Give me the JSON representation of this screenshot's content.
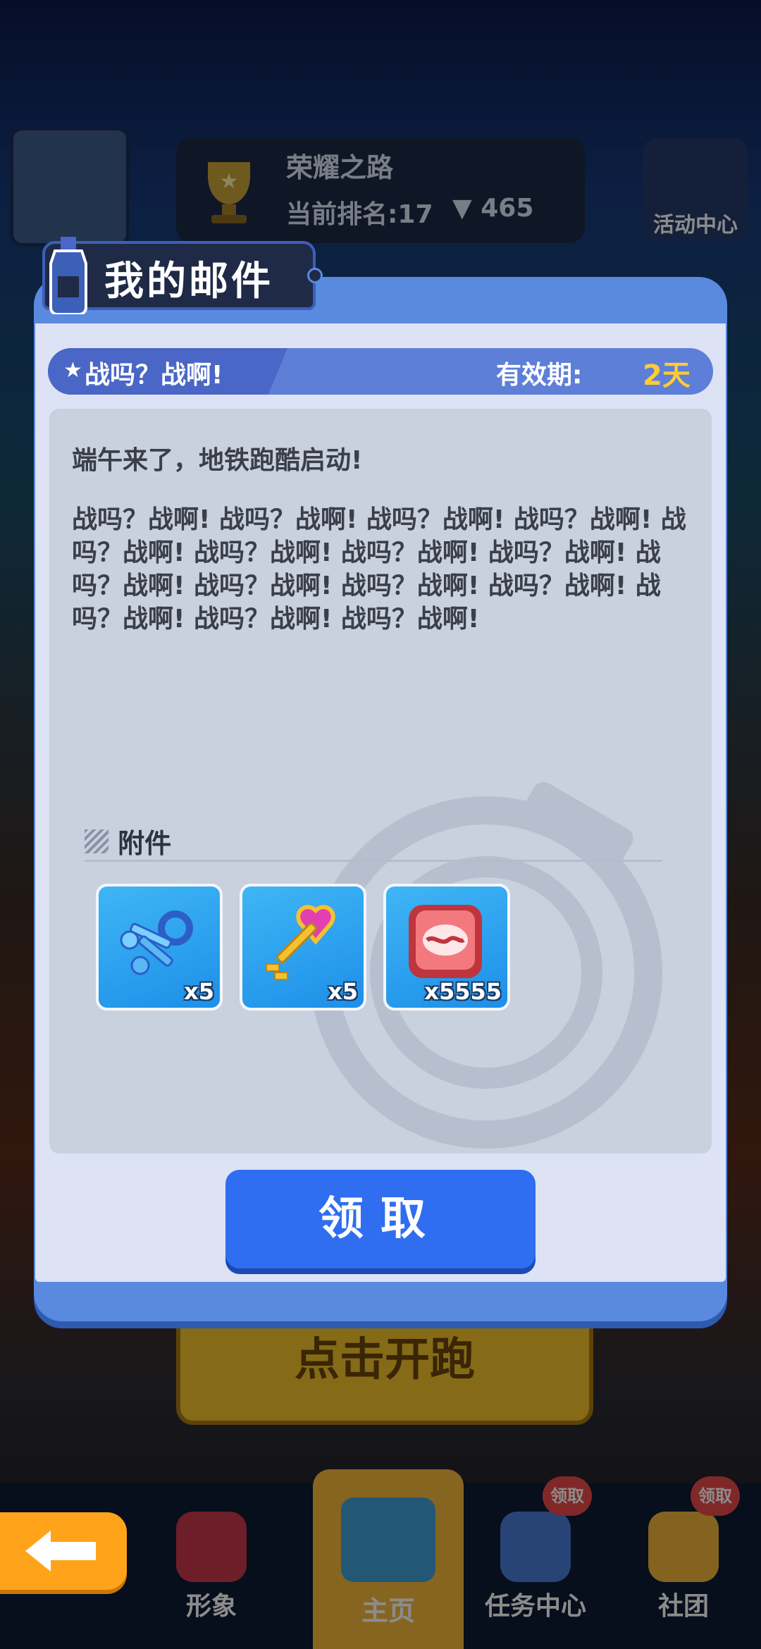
{
  "background": {
    "rank_panel": {
      "title": "荣耀之路",
      "rank": "当前排名:17",
      "cups": "465"
    },
    "event_center_label": "活动中心",
    "run_button_label": "点击开跑"
  },
  "bottom_nav": {
    "items": [
      {
        "label": "形象",
        "badge": ""
      },
      {
        "label": "主页",
        "badge": ""
      },
      {
        "label": "任务中心",
        "badge": "领取"
      },
      {
        "label": "社团",
        "badge": "领取"
      }
    ]
  },
  "modal": {
    "title": "我的邮件",
    "subject": "战吗？战啊!",
    "expiry_label": "有效期:",
    "expiry_value": "2天",
    "body_line1": "端午来了，地铁跑酷启动!",
    "body_text": "战吗？战啊! 战吗？战啊! 战吗？战啊! 战吗？战啊! 战吗？战啊! 战吗？战啊! 战吗？战啊! 战吗？战啊! 战吗？战啊! 战吗？战啊! 战吗？战啊! 战吗？战啊! 战吗？战啊! 战吗？战啊! 战吗？战啊!",
    "attachments_label": "附件",
    "attachments": [
      {
        "icon": "blue-keys-icon",
        "qty": "x5"
      },
      {
        "icon": "heart-key-icon",
        "qty": "x5"
      },
      {
        "icon": "red-token-icon",
        "qty": "x5555"
      }
    ],
    "claim_label": "领取"
  },
  "colors": {
    "modal_frame": "#5a89e0",
    "claim_button": "#2f6ef0",
    "expiry_value": "#ffcc33",
    "back_button": "#ffa41a"
  }
}
